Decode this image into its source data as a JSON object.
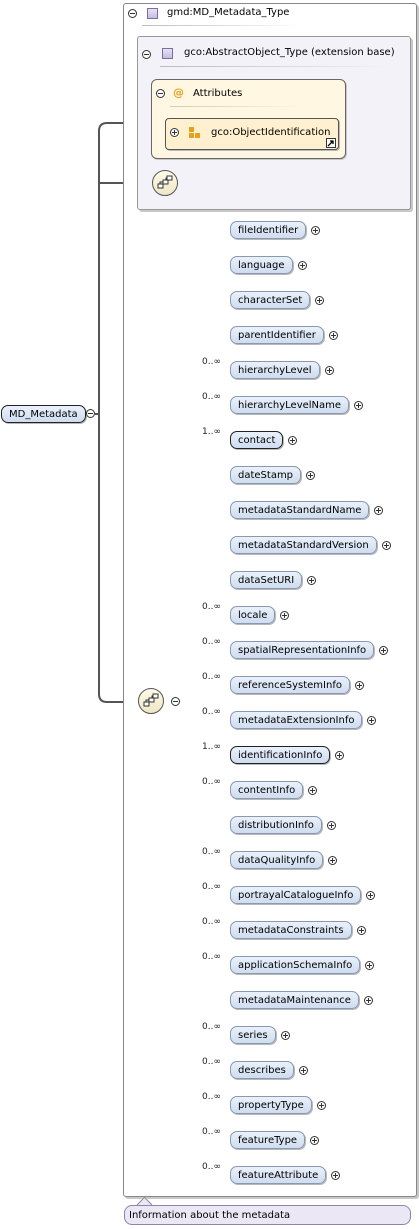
{
  "root": {
    "label": "MD_Metadata",
    "documentation": "Information about the metadata"
  },
  "type": {
    "label": "gmd:MD_Metadata_Type"
  },
  "base": {
    "label": "gco:AbstractObject_Type (extension base)"
  },
  "attributes": {
    "label": "Attributes",
    "at_symbol": "@"
  },
  "attr_group": {
    "label": "gco:ObjectIdentification"
  },
  "elements": [
    {
      "label": "fileIdentifier",
      "mult": ""
    },
    {
      "label": "language",
      "mult": ""
    },
    {
      "label": "characterSet",
      "mult": ""
    },
    {
      "label": "parentIdentifier",
      "mult": ""
    },
    {
      "label": "hierarchyLevel",
      "mult": "0..∞"
    },
    {
      "label": "hierarchyLevelName",
      "mult": "0..∞"
    },
    {
      "label": "contact",
      "mult": "1..∞"
    },
    {
      "label": "dateStamp",
      "mult": ""
    },
    {
      "label": "metadataStandardName",
      "mult": ""
    },
    {
      "label": "metadataStandardVersion",
      "mult": ""
    },
    {
      "label": "dataSetURI",
      "mult": ""
    },
    {
      "label": "locale",
      "mult": "0..∞"
    },
    {
      "label": "spatialRepresentationInfo",
      "mult": "0..∞"
    },
    {
      "label": "referenceSystemInfo",
      "mult": "0..∞"
    },
    {
      "label": "metadataExtensionInfo",
      "mult": "0..∞"
    },
    {
      "label": "identificationInfo",
      "mult": "1..∞"
    },
    {
      "label": "contentInfo",
      "mult": "0..∞"
    },
    {
      "label": "distributionInfo",
      "mult": ""
    },
    {
      "label": "dataQualityInfo",
      "mult": "0..∞"
    },
    {
      "label": "portrayalCatalogueInfo",
      "mult": "0..∞"
    },
    {
      "label": "metadataConstraints",
      "mult": "0..∞"
    },
    {
      "label": "applicationSchemaInfo",
      "mult": "0..∞"
    },
    {
      "label": "metadataMaintenance",
      "mult": ""
    },
    {
      "label": "series",
      "mult": "0..∞"
    },
    {
      "label": "describes",
      "mult": "0..∞"
    },
    {
      "label": "propertyType",
      "mult": "0..∞"
    },
    {
      "label": "featureType",
      "mult": "0..∞"
    },
    {
      "label": "featureAttribute",
      "mult": "0..∞"
    }
  ]
}
